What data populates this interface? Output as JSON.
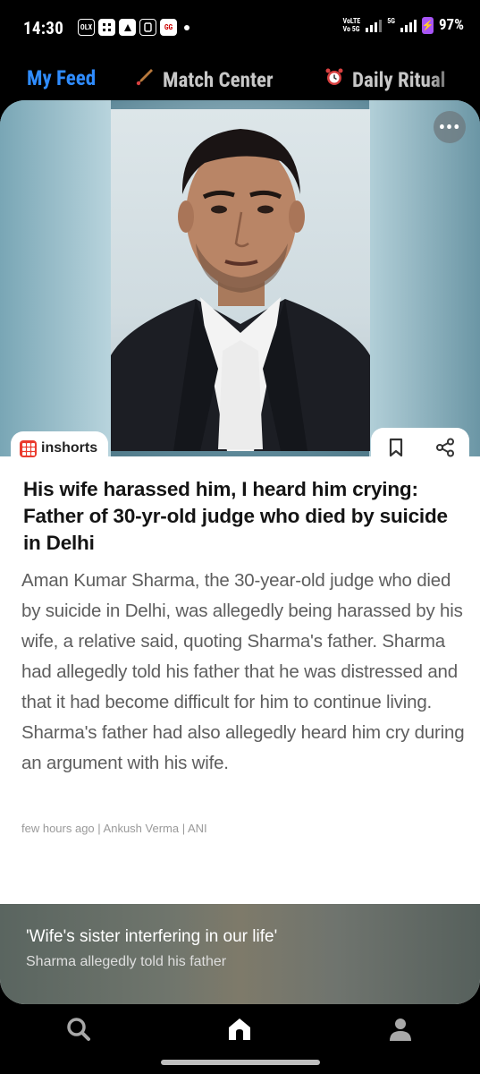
{
  "status_bar": {
    "time": "14:30",
    "notifications": [
      "olx-icon",
      "calculator-icon",
      "ipl-icon",
      "whatsapp-business-icon",
      "gaana-icon"
    ],
    "notification_labels": [
      "OLX",
      "",
      "",
      "",
      "GG"
    ],
    "network_label_line1": "VoLTE",
    "network_label_line2": "Vo 5G",
    "network_type": "5G",
    "battery_percent": "97%"
  },
  "tabs": [
    {
      "label": "My Feed",
      "icon": "",
      "active": true
    },
    {
      "label": "Match Center",
      "icon": "cricket-bat-icon",
      "active": false
    },
    {
      "label": "Daily Ritual",
      "icon": "alarm-clock-icon",
      "active": false
    }
  ],
  "article": {
    "source": "inshorts",
    "headline": "His wife harassed him, I heard him crying: Father of 30-yr-old judge who died by suicide in Delhi",
    "body": "Aman Kumar Sharma, the 30-year-old judge who died by suicide in Delhi, was allegedly being harassed by his wife, a relative said, quoting Sharma's father. Sharma had allegedly told his father that he was distressed and that it had become difficult for him to continue living. Sharma's father had also allegedly heard him cry during an argument with his wife.",
    "byline": "few hours ago | Ankush Verma | ANI",
    "more_label": "•••"
  },
  "teaser": {
    "title": "'Wife's sister interfering in our life'",
    "subtitle": "Sharma allegedly told his father"
  },
  "bottom_nav": [
    "search-icon",
    "home-icon",
    "profile-icon"
  ],
  "colors": {
    "active_tab": "#2f8cff",
    "inshorts_brand": "#ea3b2e",
    "battery": "#a855f7"
  }
}
